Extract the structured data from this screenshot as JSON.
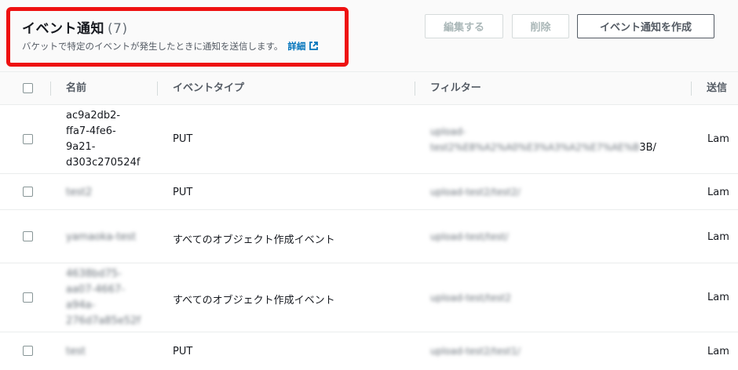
{
  "header": {
    "title": "イベント通知",
    "count": "(7)",
    "description": "バケットで特定のイベントが発生したときに通知を送信します。",
    "more_link": "詳細"
  },
  "buttons": {
    "edit": "編集する",
    "delete": "削除",
    "create": "イベント通知を作成"
  },
  "table": {
    "columns": [
      "名前",
      "イベントタイプ",
      "フィルター",
      "送信"
    ],
    "rows": [
      {
        "name_lines": [
          "ac9a2db2-",
          "ffa7-4fe6-",
          "9a21-",
          "d303c270524f"
        ],
        "event_type": "PUT",
        "filter_lines": [
          "upload-",
          "test2%E8%A2%A0%E3%A3%A2%E7%AE%B"
        ],
        "filter_tail": "3B/",
        "dest": "Lam"
      },
      {
        "name_lines": [
          "test2"
        ],
        "event_type": "PUT",
        "filter_lines": [
          "upload-test2/test2/"
        ],
        "filter_tail": "",
        "dest": "Lam"
      },
      {
        "name_lines": [
          "yamaoka-test"
        ],
        "event_type": "すべてのオブジェクト作成イベント",
        "filter_lines": [
          "upload-test/test/"
        ],
        "filter_tail": "",
        "dest": "Lam"
      },
      {
        "name_lines": [
          "4638bd75-",
          "aa07-4667-",
          "a94a-",
          "276d7a85e52f"
        ],
        "event_type": "すべてのオブジェクト作成イベント",
        "filter_lines": [
          "upload-test/test2"
        ],
        "filter_tail": "",
        "dest": "Lam"
      },
      {
        "name_lines": [
          "test"
        ],
        "event_type": "PUT",
        "filter_lines": [
          "upload-test2/test1/"
        ],
        "filter_tail": "",
        "dest": "Lam"
      }
    ]
  },
  "colors": {
    "highlight": "#ee1111",
    "link": "#0073bb"
  }
}
